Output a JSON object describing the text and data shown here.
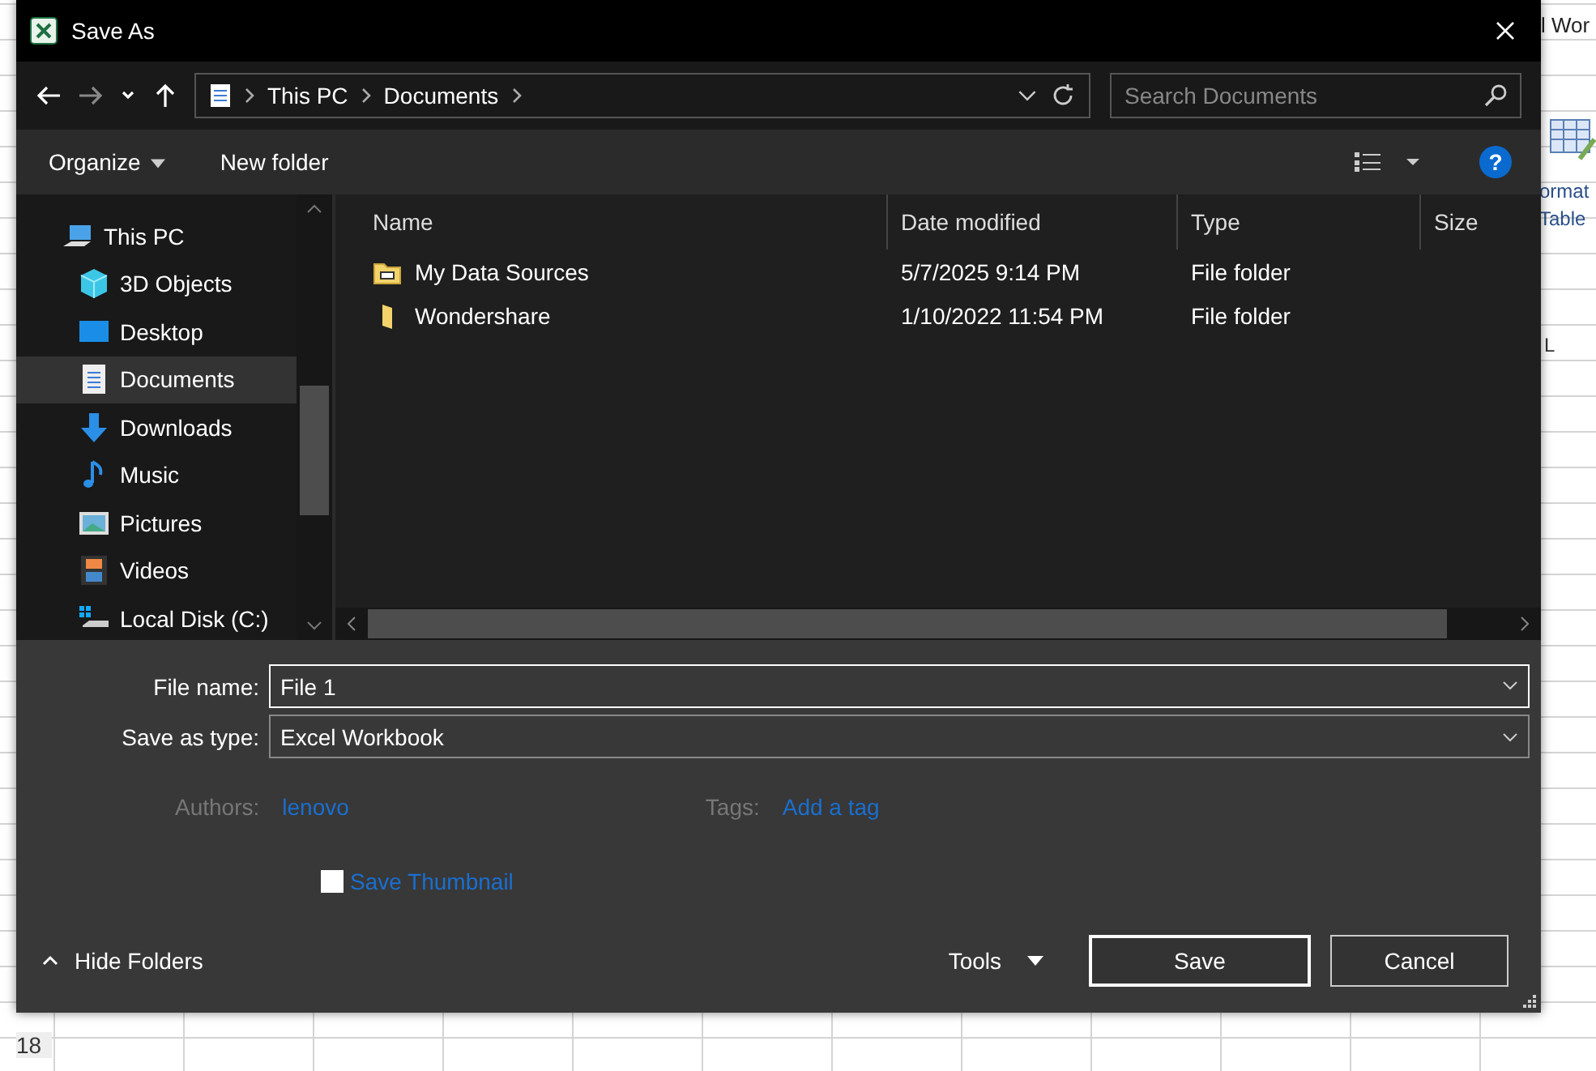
{
  "background_app": {
    "title_fragment": "l Wor",
    "ribbon_label_lines": [
      "ormat",
      "Table"
    ],
    "column_header": "L",
    "row_header": "18"
  },
  "window": {
    "title": "Save As"
  },
  "navigation": {
    "breadcrumb": [
      "This PC",
      "Documents"
    ],
    "search": {
      "placeholder": "Search Documents"
    }
  },
  "toolbar": {
    "buttons": [
      {
        "label": "Organize",
        "dropdown": true
      },
      {
        "label": "New folder",
        "dropdown": false
      }
    ],
    "help_label": "?"
  },
  "sidebar": {
    "items": [
      {
        "label": "This PC",
        "kind": "pc",
        "selected": false,
        "children": [
          {
            "label": "3D Objects",
            "kind": "cube",
            "selected": false
          },
          {
            "label": "Desktop",
            "kind": "desktop",
            "selected": false
          },
          {
            "label": "Documents",
            "kind": "documents",
            "selected": true
          },
          {
            "label": "Downloads",
            "kind": "downloads",
            "selected": false
          },
          {
            "label": "Music",
            "kind": "music",
            "selected": false
          },
          {
            "label": "Pictures",
            "kind": "pictures",
            "selected": false
          },
          {
            "label": "Videos",
            "kind": "videos",
            "selected": false
          },
          {
            "label": "Local Disk (C:)",
            "kind": "disk",
            "selected": false
          }
        ]
      }
    ]
  },
  "file_list": {
    "columns": [
      "Name",
      "Date modified",
      "Type",
      "Size"
    ],
    "rows": [
      {
        "name": "My Data Sources",
        "date": "5/7/2025 9:14 PM",
        "type": "File folder",
        "kind": "special-folder",
        "selected": false
      },
      {
        "name": "Wondershare",
        "date": "1/10/2022 11:54 PM",
        "type": "File folder",
        "kind": "folder",
        "selected": false
      }
    ]
  },
  "form": {
    "file_name": {
      "label": "File name:",
      "value": "File 1"
    },
    "save_as_type": {
      "label": "Save as type:",
      "value": "Excel Workbook"
    },
    "authors": {
      "label": "Authors:",
      "value": "lenovo"
    },
    "tags": {
      "label": "Tags:",
      "value": "Add a tag"
    },
    "save_thumbnail": {
      "label": "Save Thumbnail",
      "checked": false
    }
  },
  "footer": {
    "hide_folders": "Hide Folders",
    "tools": "Tools",
    "buttons": [
      "Save",
      "Cancel"
    ]
  }
}
